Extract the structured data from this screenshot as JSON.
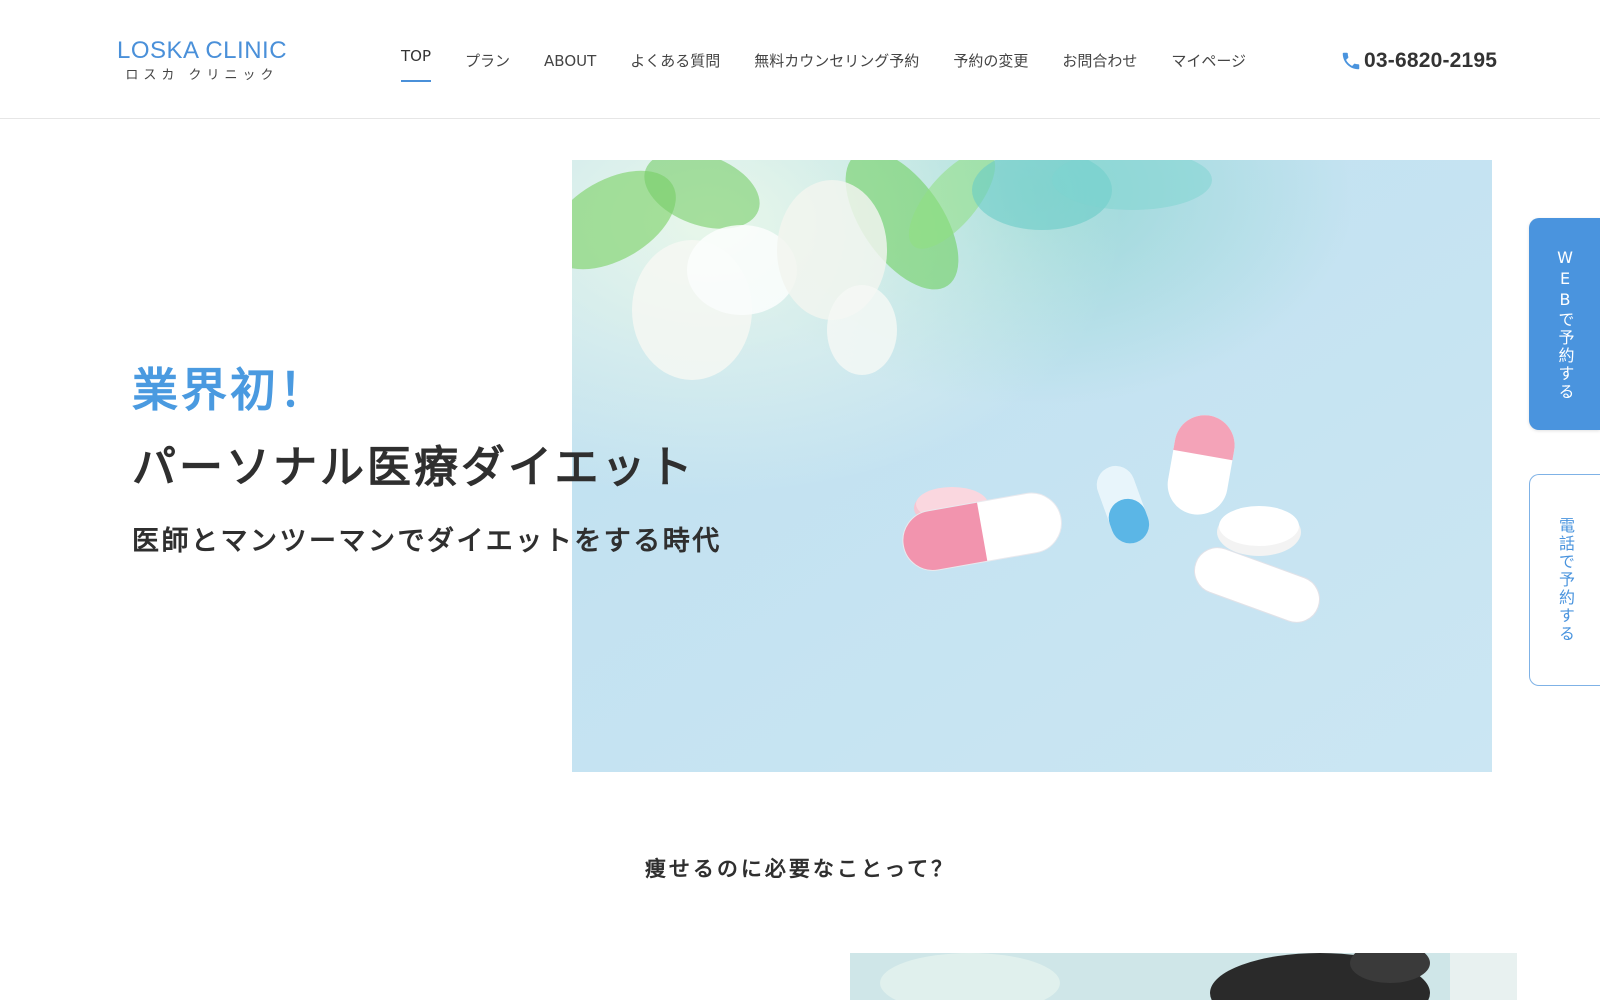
{
  "header": {
    "logo_en": "LOSKA CLINIC",
    "logo_ja": "ロスカ クリニック",
    "nav": [
      {
        "label": "TOP",
        "active": true
      },
      {
        "label": "プラン"
      },
      {
        "label": "ABOUT"
      },
      {
        "label": "よくある質問"
      },
      {
        "label": "無料カウンセリング予約"
      },
      {
        "label": "予約の変更"
      },
      {
        "label": "お問合わせ"
      },
      {
        "label": "マイページ"
      }
    ],
    "phone": "03-6820-2195",
    "phone_icon": "phone-icon"
  },
  "hero": {
    "kicker": "業界初！",
    "title": "パーソナル医療ダイエット",
    "subtitle": "医師とマンツーマンでダイエットをする時代"
  },
  "side_tabs": {
    "web": "WEBで予約する",
    "tel": "電話で予約する"
  },
  "section": {
    "question": "痩せるのに必要なことって？"
  },
  "colors": {
    "accent": "#4a94de",
    "text": "#2f2f2f",
    "hero_bg": "#c4e2f1"
  }
}
